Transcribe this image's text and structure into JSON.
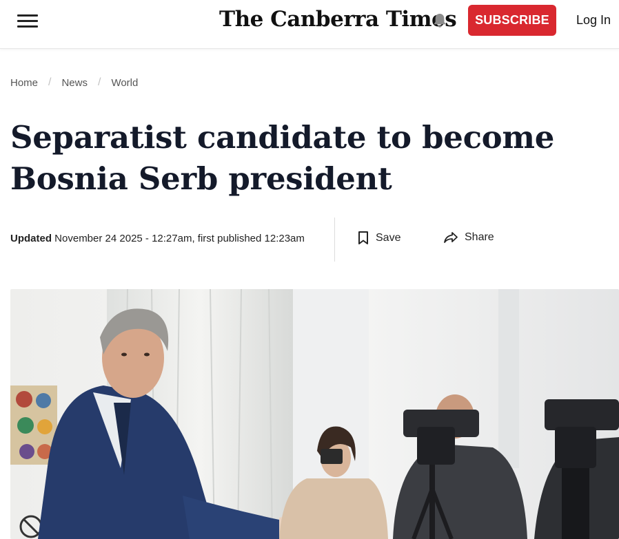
{
  "header": {
    "menu_icon": "hamburger-menu-icon",
    "logo": "The Canberra Times",
    "notification_icon": "bell-icon",
    "subscribe_label": "SUBSCRIBE",
    "login_label": "Log In",
    "brand_color": "#d9282f"
  },
  "breadcrumb": {
    "items": [
      "Home",
      "News",
      "World"
    ],
    "separator": "/"
  },
  "article": {
    "headline": "Separatist candidate to become Bosnia Serb president",
    "updated_label": "Updated",
    "updated_text": "November 24 2025 - 12:27am, first published 12:23am",
    "save_label": "Save",
    "save_icon": "bookmark-icon",
    "share_label": "Share",
    "share_icon": "share-arrow-icon"
  }
}
